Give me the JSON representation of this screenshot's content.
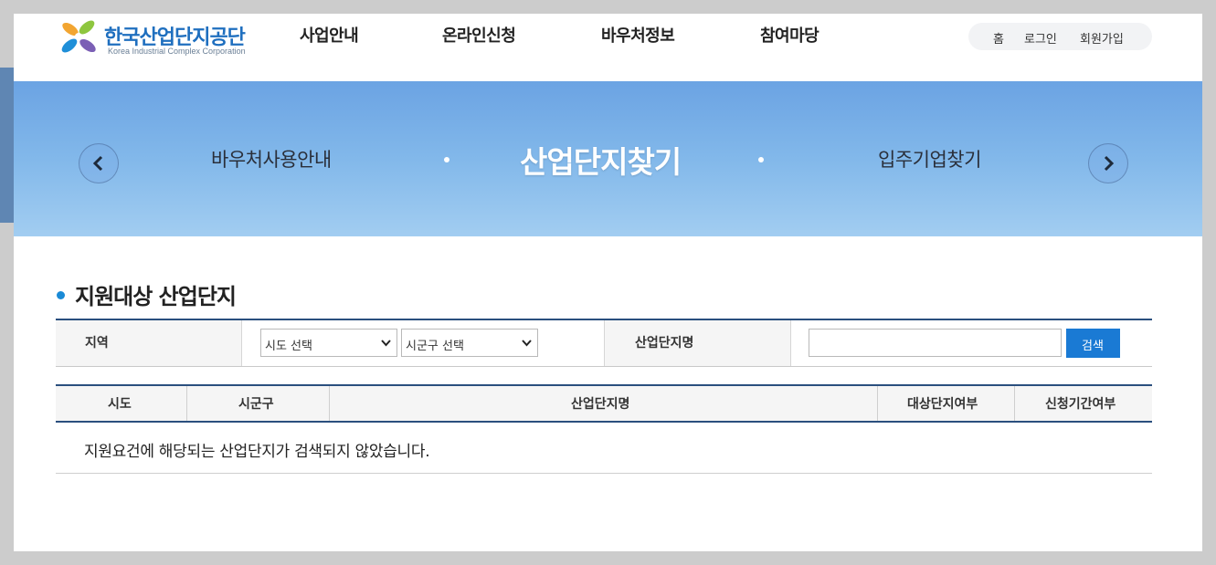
{
  "header": {
    "logo_ko": "한국산업단지공단",
    "logo_en": "Korea Industrial Complex Corporation",
    "nav": [
      "사업안내",
      "온라인신청",
      "바우처정보",
      "참여마당"
    ],
    "util": [
      "홈",
      "로그인",
      "회원가입"
    ]
  },
  "banner": {
    "prev_item": "바우처사용안내",
    "active_item": "산업단지찾기",
    "next_item": "입주기업찾기"
  },
  "section": {
    "title": "지원대상 산업단지"
  },
  "search": {
    "region_label": "지역",
    "sido_select": "시도 선택",
    "sigungu_select": "시군구 선택",
    "complex_name_label": "산업단지명",
    "complex_name_value": "",
    "search_button": "검색"
  },
  "results": {
    "columns": [
      "시도",
      "시군구",
      "산업단지명",
      "대상단지여부",
      "신청기간여부"
    ],
    "empty_message": "지원요건에 해당되는 산업단지가 검색되지 않았습니다."
  },
  "colors": {
    "brand_blue": "#1f6fbf",
    "banner_top": "#6ba3e3",
    "banner_bottom": "#a2cdf1",
    "table_border": "#2a4f7e",
    "button_blue": "#1a7ad4",
    "section_bullet": "#1a8ad6"
  }
}
